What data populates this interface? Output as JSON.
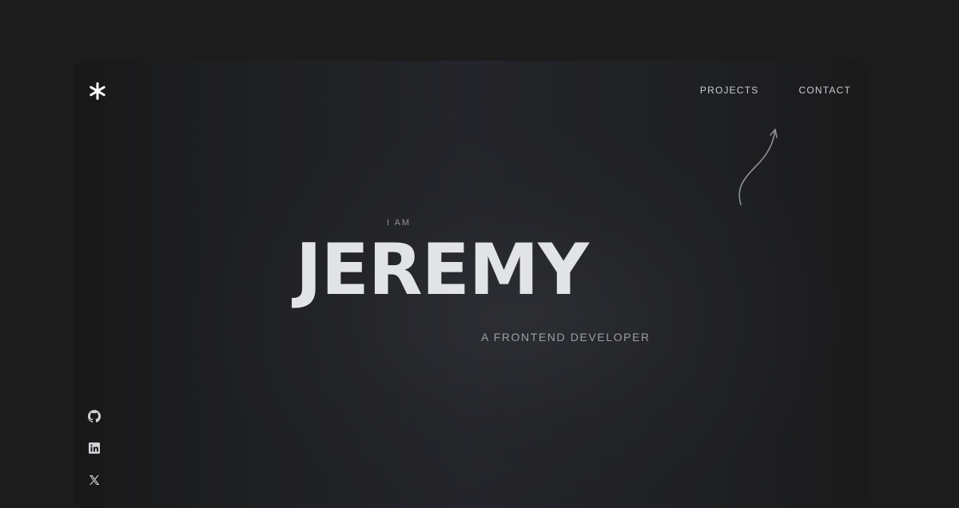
{
  "header": {
    "logo_icon": "asterisk-icon",
    "nav": [
      {
        "label": "PROJECTS"
      },
      {
        "label": "CONTACT"
      }
    ]
  },
  "hero": {
    "pretitle": "I AM",
    "name": "JEREMY",
    "role": "A FRONTEND DEVELOPER",
    "decoration_icon": "curved-arrow-icon"
  },
  "social": [
    {
      "icon": "github-icon"
    },
    {
      "icon": "linkedin-icon"
    },
    {
      "icon": "x-icon"
    }
  ],
  "colors": {
    "background": "#1c1c1c",
    "text_primary": "#e2e3e7",
    "text_secondary": "#9b9da2"
  }
}
